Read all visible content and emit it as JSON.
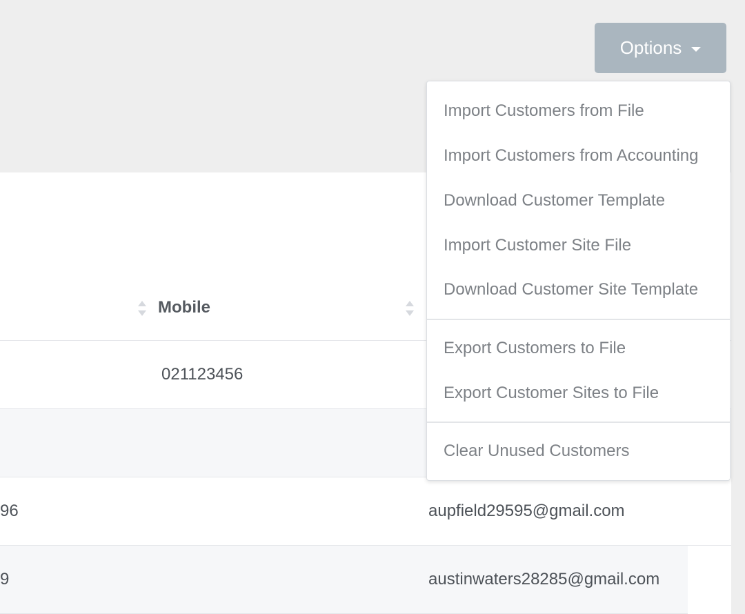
{
  "toolbar": {
    "options_label": "Options"
  },
  "table": {
    "columns": [
      {
        "label": "Mobile"
      }
    ],
    "rows": [
      {
        "left_partial": "",
        "mobile": "021123456",
        "email": ""
      },
      {
        "left_partial": "",
        "mobile": "",
        "email": ""
      },
      {
        "left_partial": "96",
        "mobile": "",
        "email": "aupfield29595@gmail.com"
      },
      {
        "left_partial": "9",
        "mobile": "",
        "email": "austinwaters28285@gmail.com"
      }
    ]
  },
  "options_menu": {
    "items": [
      {
        "label": "Import Customers from File"
      },
      {
        "label": "Import Customers from Accounting"
      },
      {
        "label": "Download Customer Template"
      },
      {
        "label": "Import Customer Site File"
      },
      {
        "label": "Download Customer Site Template"
      },
      {
        "label": "Export Customers to File"
      },
      {
        "label": "Export Customer Sites to File"
      },
      {
        "label": "Clear Unused Customers"
      }
    ]
  },
  "icons": {
    "options_caret": "caret-down-icon",
    "sort": "sort-icon"
  },
  "colors": {
    "background": "#eeeeee",
    "button": "#aab6bf",
    "alt_row": "#f6f7f9",
    "menu_text": "#7d8186",
    "table_text": "#4d5258"
  }
}
